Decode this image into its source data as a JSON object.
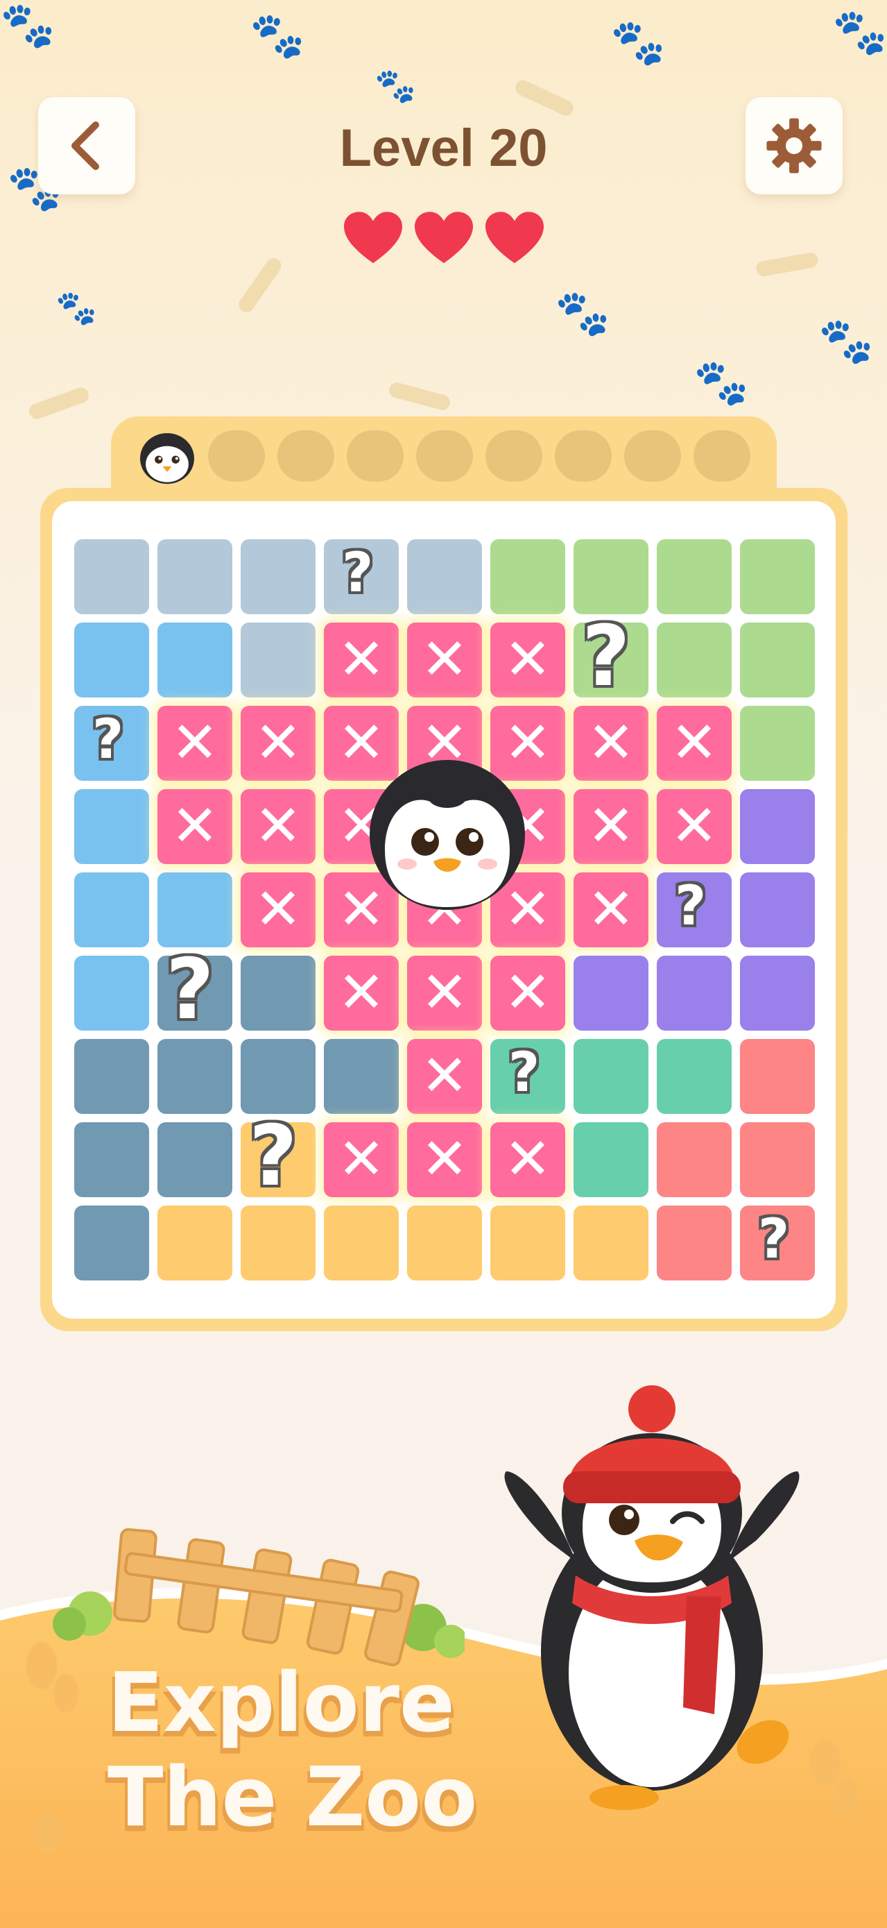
{
  "header": {
    "back_icon": "chevron-left-icon",
    "title": "Level 20",
    "settings_icon": "gear-icon"
  },
  "lives": {
    "total": 3,
    "remaining": 3,
    "icon": "heart-icon",
    "color": "#f0384f"
  },
  "progress_tab": {
    "collected": 1,
    "slots": 9,
    "collected_icon": "penguin-face-icon"
  },
  "board": {
    "rows": 9,
    "cols": 9,
    "colors": {
      "G": "#b3c9da",
      "B": "#79c2f0",
      "L": "#acdb8f",
      "P": "#9a80ea",
      "S": "#7199b2",
      "T": "#68cfad",
      "R": "#fd8585",
      "Y": "#fecb6e",
      "X": "#ff6b9d"
    },
    "cells": [
      "GGGGGLLLL",
      "BBGXXXLLL",
      "BXXXXXXXL",
      "BXXXXXXXP",
      "BBXXXXXPP",
      "BSSXXXPPP",
      "SSSSXTTTR",
      "SSYXXXTRR",
      "SYYYYYYRR"
    ],
    "hints": [
      {
        "r": 0,
        "c": 3,
        "size": "small"
      },
      {
        "r": 1,
        "c": 6,
        "size": "large"
      },
      {
        "r": 2,
        "c": 0,
        "size": "small"
      },
      {
        "r": 4,
        "c": 7,
        "size": "small"
      },
      {
        "r": 5,
        "c": 1,
        "size": "large"
      },
      {
        "r": 6,
        "c": 5,
        "size": "small"
      },
      {
        "r": 7,
        "c": 2,
        "size": "large"
      },
      {
        "r": 8,
        "c": 8,
        "size": "small"
      }
    ],
    "hint_glyph": "?",
    "mark_glyph": "✕",
    "center_piece": "penguin-face-icon"
  },
  "banner": {
    "line1": "Explore",
    "line2": "The Zoo"
  }
}
